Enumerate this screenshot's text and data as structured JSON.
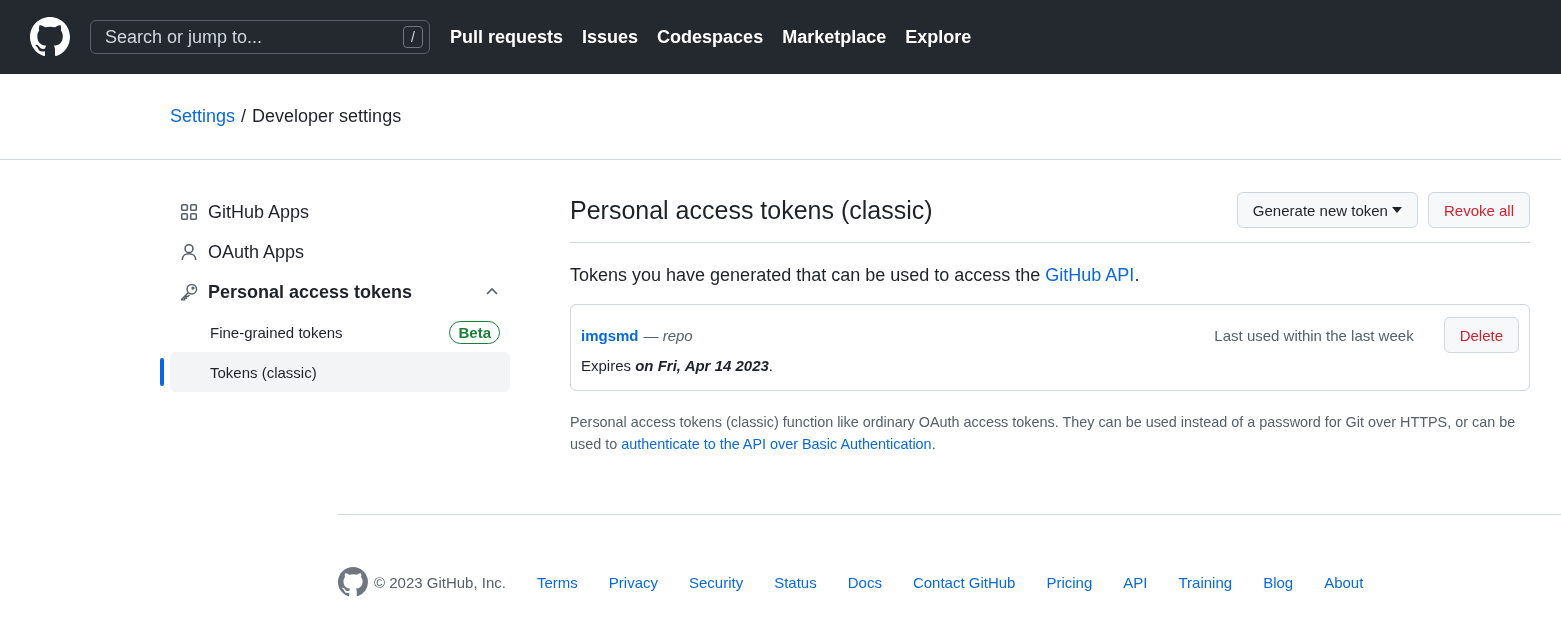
{
  "header": {
    "search": {
      "placeholder": "Search or jump to...",
      "shortcut": "/"
    },
    "nav": [
      "Pull requests",
      "Issues",
      "Codespaces",
      "Marketplace",
      "Explore"
    ]
  },
  "breadcrumb": {
    "link": "Settings",
    "separator": "/",
    "current": "Developer settings"
  },
  "sidebar": {
    "items": [
      {
        "label": "GitHub Apps",
        "selected": false
      },
      {
        "label": "OAuth Apps",
        "selected": false
      },
      {
        "label": "Personal access tokens",
        "selected": false,
        "expanded": true,
        "children": [
          {
            "label": "Fine-grained tokens",
            "badge": "Beta",
            "selected": false
          },
          {
            "label": "Tokens (classic)",
            "selected": true
          }
        ]
      }
    ]
  },
  "main": {
    "title": "Personal access tokens (classic)",
    "buttons": [
      {
        "label": "Generate new token",
        "kind": "dropdown"
      },
      {
        "label": "Revoke all",
        "kind": "danger"
      }
    ],
    "intro": {
      "text": "Tokens you have generated that can be used to access the ",
      "link": "GitHub API",
      "after": "."
    },
    "tokens": [
      {
        "name": "imgsmd",
        "scopes": "— repo",
        "last_used": "Last used within the last week",
        "expires": "Expires **on Fri, Apr 14 2023**.",
        "button": "Delete"
      }
    ],
    "note": {
      "text": "Personal access tokens (classic) function like ordinary OAuth access tokens. They can be used instead of a password for Git over HTTPS, or can be used to ",
      "link": "authenticate to the API over Basic Authentication",
      "after": "."
    }
  },
  "footer": {
    "copyright": "© 2023 GitHub, Inc.",
    "links": [
      "Terms",
      "Privacy",
      "Security",
      "Status",
      "Docs",
      "Contact GitHub",
      "Pricing",
      "API",
      "Training",
      "Blog",
      "About"
    ]
  }
}
